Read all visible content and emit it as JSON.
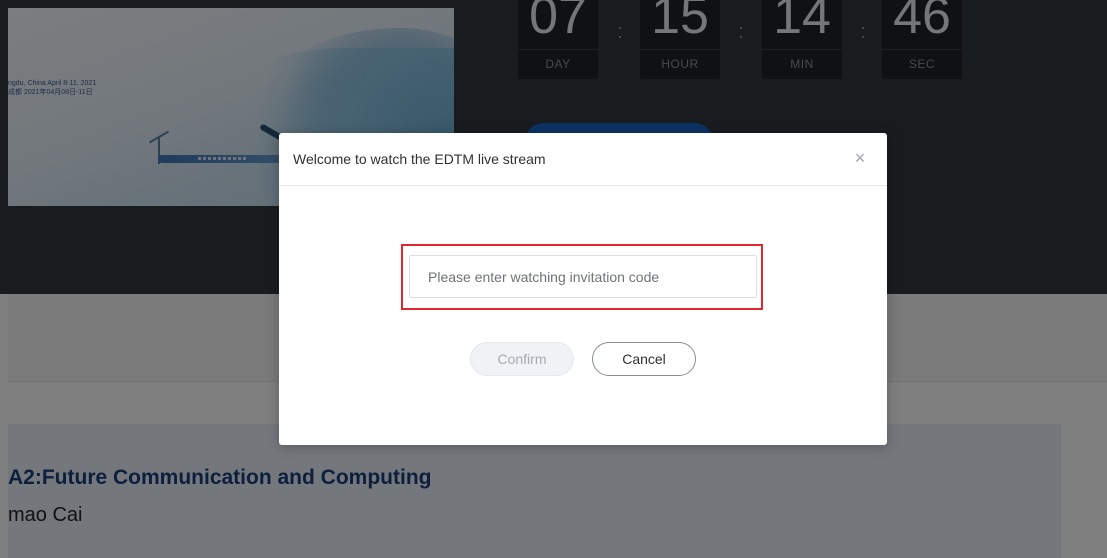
{
  "banner": {
    "event_line": "ngdu, China  April 8-11, 2021",
    "event_line_cn": "成都  2021年04月08日-11日"
  },
  "countdown": [
    {
      "value": "07",
      "label": "DAY"
    },
    {
      "value": "15",
      "label": "HOUR"
    },
    {
      "value": "14",
      "label": "MIN"
    },
    {
      "value": "46",
      "label": "SEC"
    }
  ],
  "session": {
    "title": "A2:Future Communication and Computing",
    "chair": "mao Cai"
  },
  "modal": {
    "title": "Welcome to watch the EDTM live stream",
    "close_icon": "×",
    "input_placeholder": "Please enter watching invitation code",
    "input_value": "",
    "confirm_label": "Confirm",
    "cancel_label": "Cancel"
  },
  "colors": {
    "highlight_border": "#e3262b",
    "hero_background": "#33383f",
    "session_title": "#1c3f7a"
  }
}
